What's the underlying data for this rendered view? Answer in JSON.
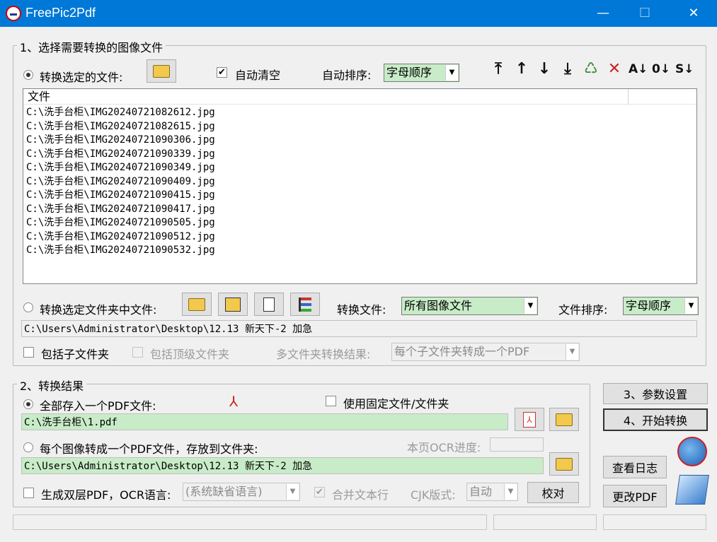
{
  "window": {
    "title": "FreePic2Pdf",
    "minimize": "—",
    "maximize": "☐",
    "close": "✕"
  },
  "section1": {
    "title": "1、选择需要转换的图像文件",
    "radio_files": "转换选定的文件:",
    "auto_clear": "自动清空",
    "auto_sort_label": "自动排序:",
    "auto_sort_value": "字母顺序",
    "list_header": "文件",
    "files": [
      "C:\\洗手台柜\\IMG20240721082612.jpg",
      "C:\\洗手台柜\\IMG20240721082615.jpg",
      "C:\\洗手台柜\\IMG20240721090306.jpg",
      "C:\\洗手台柜\\IMG20240721090339.jpg",
      "C:\\洗手台柜\\IMG20240721090349.jpg",
      "C:\\洗手台柜\\IMG20240721090409.jpg",
      "C:\\洗手台柜\\IMG20240721090415.jpg",
      "C:\\洗手台柜\\IMG20240721090417.jpg",
      "C:\\洗手台柜\\IMG20240721090505.jpg",
      "C:\\洗手台柜\\IMG20240721090512.jpg",
      "C:\\洗手台柜\\IMG20240721090532.jpg"
    ],
    "radio_folder": "转换选定文件夹中文件:",
    "convert_files_label": "转换文件:",
    "convert_files_value": "所有图像文件",
    "file_sort_label": "文件排序:",
    "file_sort_value": "字母顺序",
    "folder_path": "C:\\Users\\Administrator\\Desktop\\12.13 新天下-2 加急",
    "include_subfolders": "包括子文件夹",
    "include_top": "包括顶级文件夹",
    "multi_result_label": "多文件夹转换结果:",
    "multi_result_value": "每个子文件夹转成一个PDF"
  },
  "section2": {
    "title": "2、转换结果",
    "radio_single": "全部存入一个PDF文件:",
    "use_fixed": "使用固定文件/文件夹",
    "single_path": "C:\\洗手台柜\\1.pdf",
    "radio_each": "每个图像转成一个PDF文件，存放到文件夹:",
    "ocr_progress_label": "本页OCR进度:",
    "each_path": "C:\\Users\\Administrator\\Desktop\\12.13 新天下-2 加急",
    "dual_layer": "生成双层PDF，OCR语言:",
    "ocr_lang_value": "(系统缺省语言)",
    "merge_lines": "合并文本行",
    "cjk_label": "CJK版式:",
    "cjk_value": "自动",
    "proofread": "校对"
  },
  "side": {
    "params": "3、参数设置",
    "start": "4、开始转换",
    "view_log": "查看日志",
    "edit_pdf": "更改PDF"
  },
  "toolbar_icons": {
    "top": "⤒",
    "up": "↑",
    "down": "↓",
    "bottom": "⤓",
    "delete_all": "♺",
    "delete": "✕",
    "sort_az": "A↓",
    "sort_09": "0↓",
    "sort_s": "S↓"
  },
  "colors": {
    "titlebar": "#0078d7",
    "field_green": "#c8ecc8",
    "accent_red": "#cc2222"
  }
}
